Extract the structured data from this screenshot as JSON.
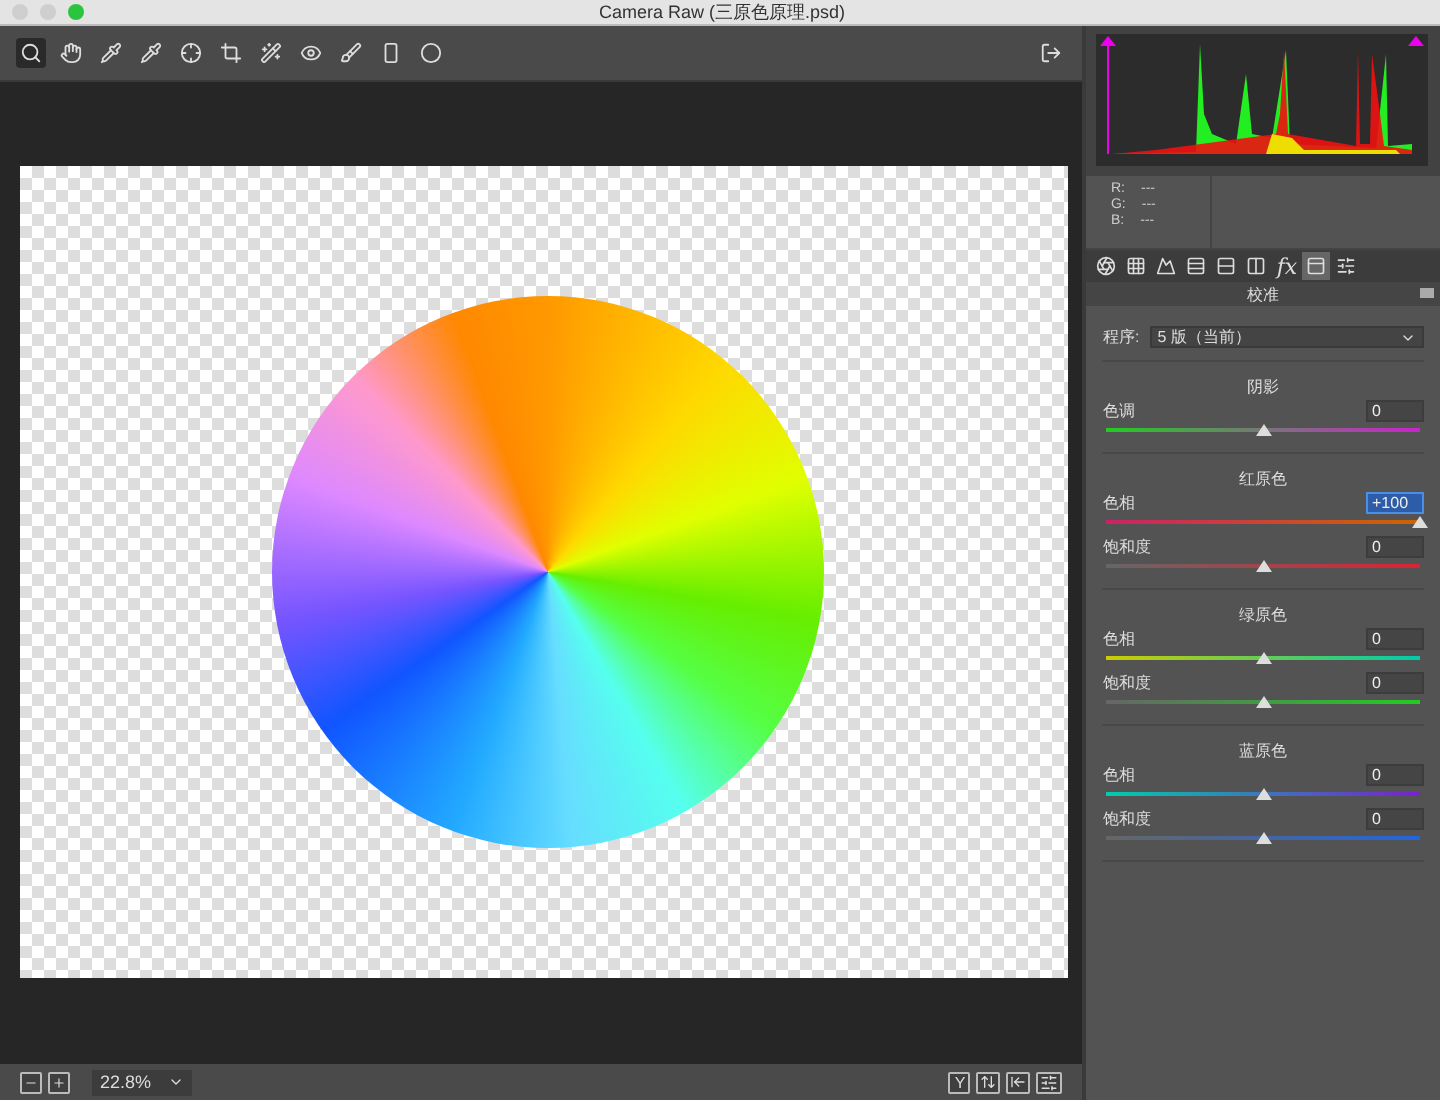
{
  "window": {
    "title": "Camera Raw (三原色原理.psd)"
  },
  "tools": [
    {
      "kind": "zoom",
      "selected": true
    },
    {
      "kind": "hand",
      "selected": false
    },
    {
      "kind": "picker",
      "selected": false
    },
    {
      "kind": "picker",
      "selected": false
    },
    {
      "kind": "target",
      "selected": false
    },
    {
      "kind": "crop",
      "selected": false
    },
    {
      "kind": "wand",
      "selected": false
    },
    {
      "kind": "eye",
      "selected": false
    },
    {
      "kind": "brush",
      "selected": false
    },
    {
      "kind": "gradient",
      "selected": false
    },
    {
      "kind": "radial",
      "selected": false
    }
  ],
  "readout": [
    {
      "label": "R:",
      "value": "---"
    },
    {
      "label": "G:",
      "value": "---"
    },
    {
      "label": "B:",
      "value": "---"
    }
  ],
  "panel_tabs": [
    {
      "kind": "basic",
      "selected": false
    },
    {
      "kind": "curve",
      "selected": false
    },
    {
      "kind": "detail",
      "selected": false
    },
    {
      "kind": "hsl",
      "selected": false
    },
    {
      "kind": "split",
      "selected": false
    },
    {
      "kind": "lens",
      "selected": false
    },
    {
      "kind": "fx",
      "label": "fx",
      "selected": false
    },
    {
      "kind": "calib",
      "selected": true
    },
    {
      "kind": "presets",
      "selected": false
    }
  ],
  "panel": {
    "title": "校准",
    "process_label": "程序:",
    "process_value": "5 版（当前）"
  },
  "sections": [
    {
      "title": "阴影",
      "kind": "shadow",
      "sliders": [
        {
          "label": "色调",
          "kind": "tint",
          "value": "0",
          "level": 0.5,
          "focused": false
        }
      ]
    },
    {
      "title": "红原色",
      "kind": "red",
      "sliders": [
        {
          "label": "色相",
          "kind": "hue",
          "value": "+100",
          "level": 1,
          "focused": true
        },
        {
          "label": "饱和度",
          "kind": "saturation",
          "value": "0",
          "level": 0.5,
          "focused": false
        }
      ]
    },
    {
      "title": "绿原色",
      "kind": "green",
      "sliders": [
        {
          "label": "色相",
          "kind": "hue",
          "value": "0",
          "level": 0.5,
          "focused": false
        },
        {
          "label": "饱和度",
          "kind": "saturation",
          "value": "0",
          "level": 0.5,
          "focused": false
        }
      ]
    },
    {
      "title": "蓝原色",
      "kind": "blue",
      "sliders": [
        {
          "label": "色相",
          "kind": "hue",
          "value": "0",
          "level": 0.5,
          "focused": false
        },
        {
          "label": "饱和度",
          "kind": "saturation",
          "value": "0",
          "level": 0.5,
          "focused": false
        }
      ]
    }
  ],
  "status": {
    "zoom": "22.8%",
    "view_buttons": [
      {
        "kind": "text",
        "label": "Y"
      },
      {
        "kind": "swap"
      },
      {
        "kind": "copy"
      },
      {
        "kind": "settings"
      }
    ]
  }
}
